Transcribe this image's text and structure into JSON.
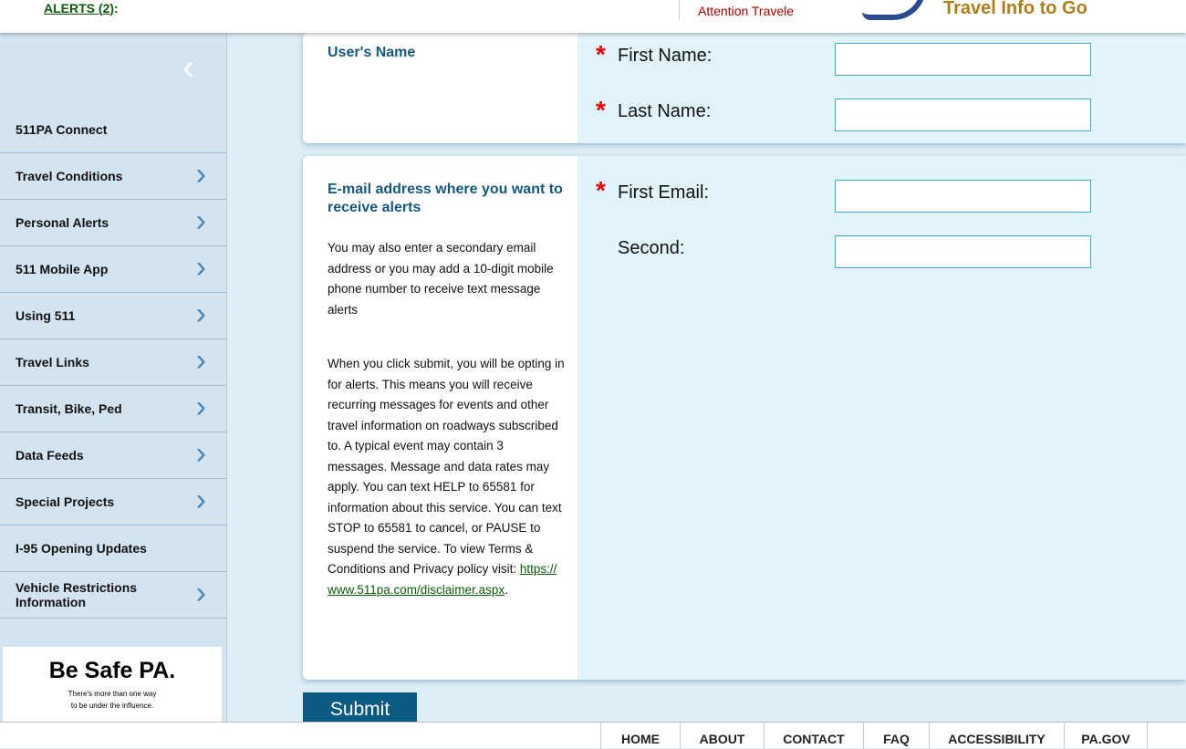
{
  "header": {
    "alerts_label": "ALERTS",
    "alerts_count": "2",
    "alerts_suffix": ":",
    "attention": "Attention Travele",
    "tagline": "Travel Info to Go"
  },
  "sidebar": {
    "items": [
      {
        "label": "511PA Connect",
        "chevron": false
      },
      {
        "label": "Travel Conditions",
        "chevron": true
      },
      {
        "label": "Personal Alerts",
        "chevron": true
      },
      {
        "label": "511 Mobile App",
        "chevron": true
      },
      {
        "label": "Using 511",
        "chevron": true
      },
      {
        "label": "Travel Links",
        "chevron": true
      },
      {
        "label": "Transit, Bike, Ped",
        "chevron": true
      },
      {
        "label": "Data Feeds",
        "chevron": true
      },
      {
        "label": "Special Projects",
        "chevron": true
      },
      {
        "label": "I-95 Opening Updates",
        "chevron": false
      },
      {
        "label": "Vehicle Restrictions Information",
        "chevron": true
      }
    ],
    "ad": {
      "title": "Be Safe PA.",
      "line1": "There's more than one way",
      "line2": "to be under the influence."
    }
  },
  "name_section": {
    "title": "User's Name",
    "first_label": "First Name:",
    "last_label": "Last Name:",
    "first_value": "",
    "last_value": ""
  },
  "email_section": {
    "title": "E-mail address where you want to receive alerts",
    "desc1": "You may also enter a secondary email address or you may add a 10-digit mobile phone number to receive text message alerts",
    "desc2": "When you click submit, you will be opting in for alerts. This means you will receive recurring messages for events and other travel information on roadways subscribed to. A typical event may contain 3 messages. Message and data rates may apply. You can text HELP to 65581 for information about this service. You can text STOP to 65581 to cancel, or PAUSE to suspend the service. To view Terms & Conditions and Privacy policy visit: ",
    "link": "https://www.511pa.com/disclaimer.aspx",
    "desc2_end": ".",
    "first_label": "First Email:",
    "second_label": "Second:",
    "first_value": "",
    "second_value": ""
  },
  "submit_label": "Submit",
  "footer": {
    "links": [
      "HOME",
      "ABOUT",
      "CONTACT",
      "FAQ",
      "ACCESSIBILITY",
      "PA.GOV"
    ]
  }
}
